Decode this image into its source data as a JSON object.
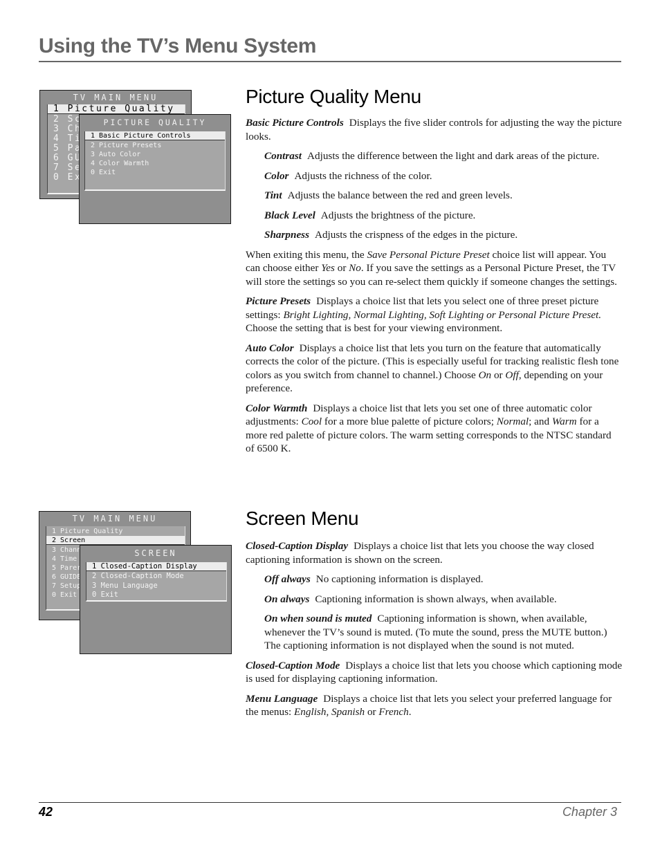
{
  "header": {
    "title": "Using the TV’s Menu System"
  },
  "picture_quality": {
    "title": "Picture Quality Menu",
    "main_menu": {
      "title": "TV MAIN MENU",
      "items": [
        "1 Picture Quality",
        "2 Sc",
        "3 Ch",
        "4 Ti",
        "5 Pa",
        "6 GU",
        "7 Se",
        "0 Ex"
      ],
      "selected_index": 0
    },
    "sub_menu": {
      "title": "PICTURE QUALITY",
      "items": [
        "1 Basic Picture Controls",
        "2 Picture Presets",
        "3 Auto Color",
        "4 Color Warmth",
        "0 Exit"
      ],
      "selected_index": 0
    },
    "paragraphs": [
      {
        "term": "Basic Picture Controls",
        "text": "Displays the five slider controls for adjusting the way the picture looks.",
        "indent": false
      },
      {
        "term": "Contrast",
        "text": "Adjusts the difference between the light and dark areas of the picture.",
        "indent": true
      },
      {
        "term": "Color",
        "text": "Adjusts the richness of the color.",
        "indent": true
      },
      {
        "term": "Tint",
        "text": "Adjusts the balance between the red and green levels.",
        "indent": true
      },
      {
        "term": "Black Level",
        "text": "Adjusts the brightness of the picture.",
        "indent": true
      },
      {
        "term": "Sharpness",
        "text": "Adjusts the crispness of the edges in the picture.",
        "indent": true
      }
    ],
    "exit_note": {
      "t1": "When exiting this menu, the ",
      "e1": "Save Personal Picture Preset",
      "t2": " choice list will appear. You can choose either ",
      "e2": "Yes",
      "t3": " or ",
      "e3": "No",
      "t4": ". If you save the settings as a Personal Picture Preset, the TV will store the settings so you can re-select them quickly if someone changes the settings."
    },
    "presets": {
      "term": "Picture Presets",
      "t1": "Displays a choice list that lets you select one of three preset picture settings: ",
      "e1": "Bright Lighting, Normal Lighting, Soft Lighting or Personal Picture Preset.",
      "t2": " Choose the setting that is best for your viewing environment."
    },
    "auto_color": {
      "term": "Auto Color",
      "t1": "Displays a choice list that lets you turn on the feature that automatically corrects the color of the picture. (This is especially useful for tracking realistic flesh tone colors as you switch from channel to channel.) Choose ",
      "e1": "On",
      "t2": " or ",
      "e2": "Off",
      "t3": ", depending on your preference."
    },
    "color_warmth": {
      "term": "Color Warmth",
      "t1": "Displays a choice list that lets you set one of three automatic color adjustments: ",
      "e1": "Cool",
      "t2": " for a more blue palette of picture colors; ",
      "e2": "Normal",
      "t3": "; and ",
      "e3": "Warm",
      "t4": " for a more red palette of picture colors. The warm setting corresponds to the NTSC standard of 6500 K."
    }
  },
  "screen": {
    "title": "Screen Menu",
    "main_menu": {
      "title": "TV MAIN MENU",
      "items": [
        "1 Picture Quality",
        "2 Screen",
        "3 Chann",
        "4 Time",
        "5 Parer",
        "6 GUIDE",
        "7 Setup",
        "0 Exit"
      ],
      "selected_index": 1
    },
    "sub_menu": {
      "title": "SCREEN",
      "items": [
        "1 Closed-Caption Display",
        "2 Closed-Caption Mode",
        "3 Menu Language",
        "0 Exit"
      ],
      "selected_index": 0
    },
    "cc_display": {
      "term": "Closed-Caption Display",
      "text": "Displays a choice list that lets you choose the way closed captioning information is shown on the screen."
    },
    "cc_options": [
      {
        "term": "Off always",
        "text": "No captioning information is displayed."
      },
      {
        "term": "On always",
        "text": "Captioning information is shown always, when available."
      },
      {
        "term": "On when sound is muted",
        "text": "Captioning information is shown, when available, whenever the TV’s sound is muted. (To mute the sound, press the MUTE button.) The captioning information is not displayed when the sound is not muted."
      }
    ],
    "cc_mode": {
      "term": "Closed-Caption Mode",
      "text": "Displays a choice list that lets you choose which captioning mode is used for displaying captioning information."
    },
    "menu_language": {
      "term": "Menu Language",
      "t1": "Displays a choice list that lets you select your preferred language for the menus: ",
      "e1": "English",
      "t2": ", ",
      "e2": "Spanish",
      "t3": " or ",
      "e3": "French",
      "t4": "."
    }
  },
  "footer": {
    "page_number": "42",
    "chapter": "Chapter 3"
  }
}
